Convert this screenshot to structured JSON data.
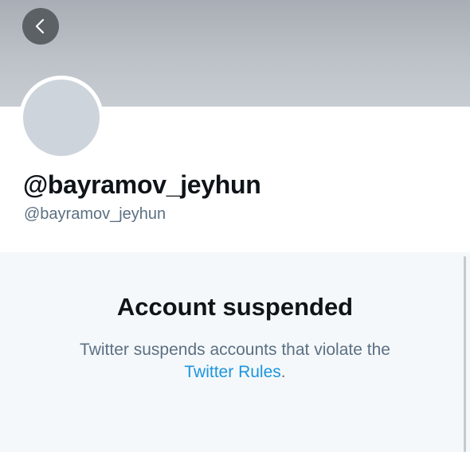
{
  "header": {
    "back_icon": "chevron-left-icon"
  },
  "profile": {
    "display_name": "@bayramov_jeyhun",
    "handle": "@bayramov_jeyhun",
    "avatar": "default-avatar"
  },
  "notice": {
    "title": "Account suspended",
    "body_text": "Twitter suspends accounts that violate the",
    "link_text": "Twitter Rules",
    "trailing_punct": "."
  },
  "colors": {
    "link": "#1b95e0",
    "secondary_text": "#5b7083",
    "primary_text": "#0f1419",
    "panel_bg": "#f5f8fa"
  }
}
